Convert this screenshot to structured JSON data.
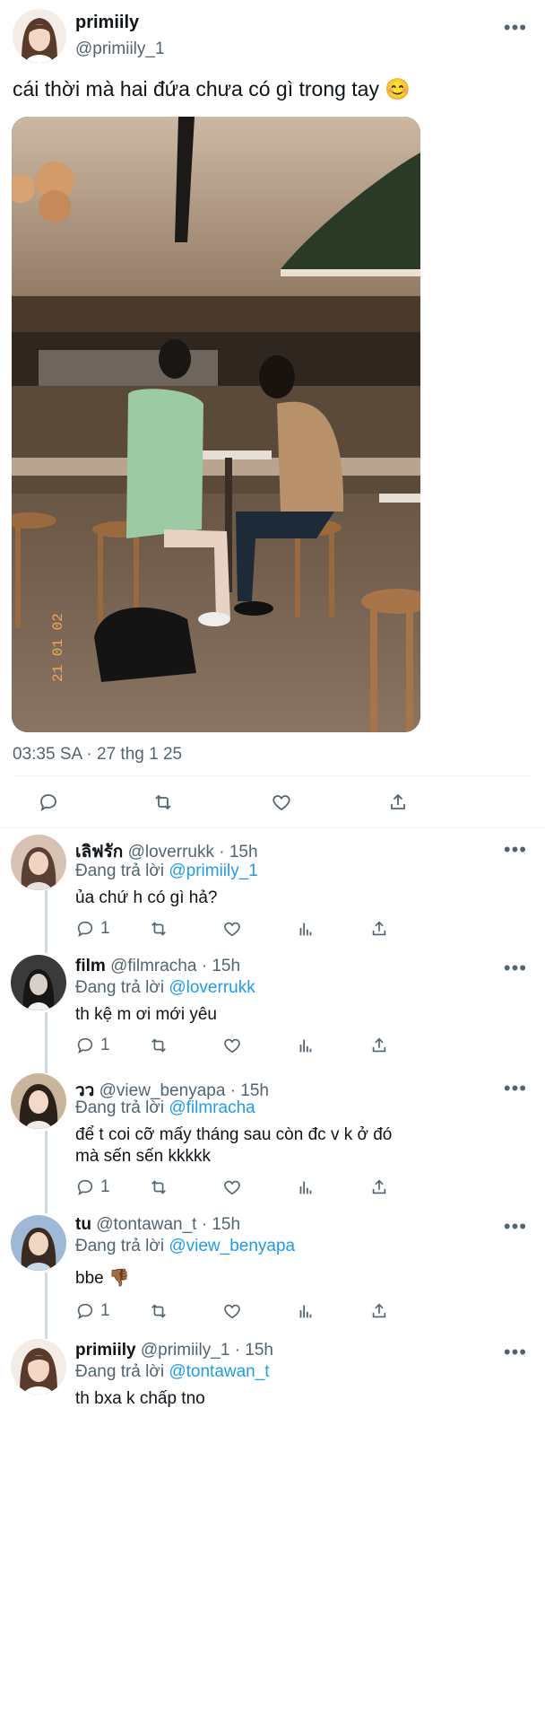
{
  "main_tweet": {
    "display_name": "primiily",
    "handle": "@primiily_1",
    "text": "cái thời mà hai đứa chưa có gì trong tay 😊",
    "photo_stamp": "21 01 02",
    "time": "03:35 SA",
    "separator": "·",
    "date": "27 thg 1 25",
    "actions": [
      "reply-icon",
      "retweet-icon",
      "like-icon",
      "share-icon"
    ]
  },
  "more_icon": "•••",
  "replies": [
    {
      "display_name": "เลิฟรัก",
      "handle": "@loverrukk",
      "age": "· 15h",
      "replying_prefix": "Đang trả lời",
      "replying_to": "@primiily_1",
      "lines": [
        "ủa chứ h có gì hả?"
      ],
      "reply_count": "1",
      "avatar_bg": "#d8c2b4"
    },
    {
      "display_name": "film",
      "handle": "@filmracha",
      "age": "· 15h",
      "replying_prefix": "Đang trả lời",
      "replying_to": "@loverrukk",
      "lines": [
        "th kệ m ơi mới yêu"
      ],
      "reply_count": "1",
      "avatar_bg": "#3a3a3a"
    },
    {
      "display_name": "วว",
      "handle": "@view_benyapa",
      "age": "· 15h",
      "replying_prefix": "Đang trả lời",
      "replying_to": "@filmracha",
      "lines": [
        "để t coi cỡ mấy tháng sau còn đc v k ở đó",
        "mà sến sến kkkkk"
      ],
      "reply_count": "1",
      "avatar_bg": "#c9b59a"
    },
    {
      "display_name": "tu",
      "handle": "@tontawan_t",
      "age": "· 15h",
      "replying_prefix": "Đang trả lời",
      "replying_to": "@view_benyapa",
      "lines": [
        "bbe 👎🏾"
      ],
      "reply_count": "1",
      "avatar_bg": "#9fb8d6"
    },
    {
      "display_name": "primiily",
      "handle": "@primiily_1",
      "age": "· 15h",
      "replying_prefix": "Đang trả lời",
      "replying_to": "@tontawan_t",
      "lines": [
        "th bxa k chấp tno"
      ],
      "reply_count": "",
      "avatar_bg": "#e8d8d0"
    }
  ],
  "colors": {
    "accent": "#1d9bf0",
    "muted": "#536471",
    "divider": "#eff3f4",
    "thread_line": "#cfd9de"
  }
}
